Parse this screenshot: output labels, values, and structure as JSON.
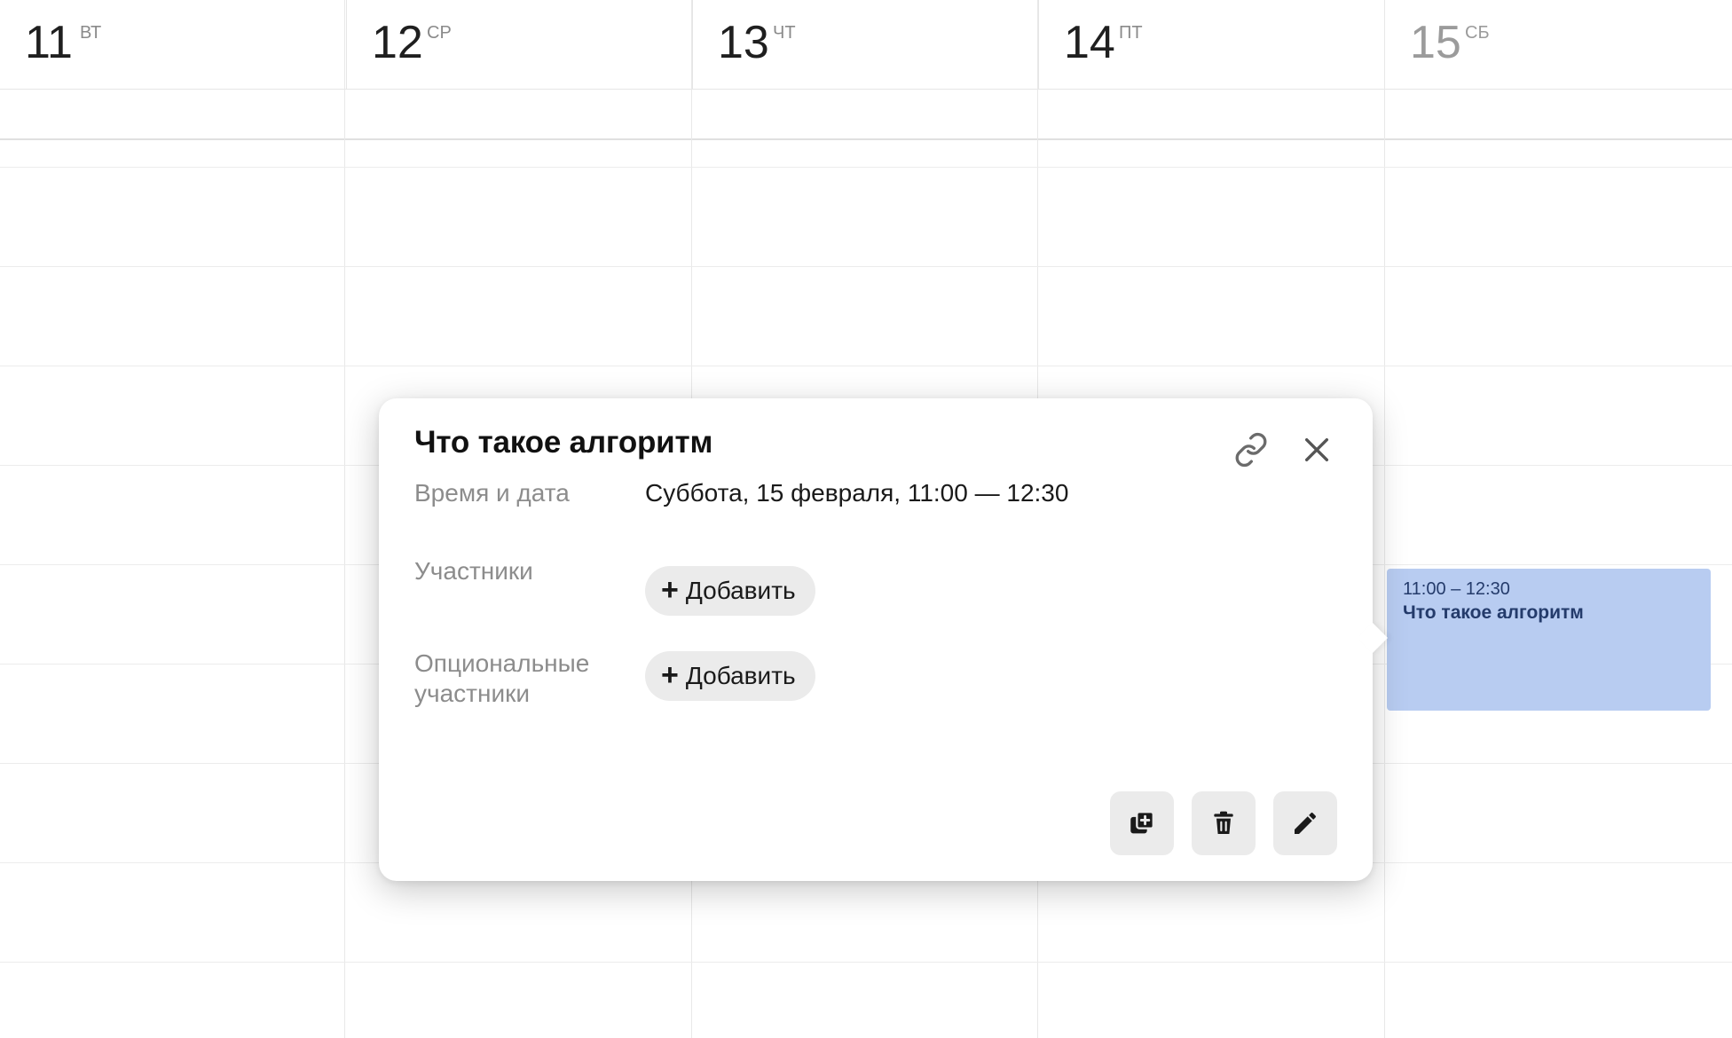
{
  "days": [
    {
      "num": "11",
      "weekday": "ВТ",
      "weekend": false
    },
    {
      "num": "12",
      "weekday": "СР",
      "weekend": false
    },
    {
      "num": "13",
      "weekday": "ЧТ",
      "weekend": false
    },
    {
      "num": "14",
      "weekday": "ПТ",
      "weekend": false
    },
    {
      "num": "15",
      "weekday": "СБ",
      "weekend": true
    }
  ],
  "event": {
    "time": "11:00 – 12:30",
    "title": "Что такое алгоритм",
    "color": "#b8ccf1"
  },
  "popup": {
    "title": "Что такое алгоритм",
    "link_icon": "link-icon",
    "close_icon": "close-icon",
    "datetime_label": "Время и дата",
    "datetime_value": "Суббота, 15 февраля, 11:00 — 12:30",
    "participants_label": "Участники",
    "optional_label_line1": "Опциональные",
    "optional_label_line2": "участники",
    "add_label": "Добавить",
    "actions": {
      "duplicate_icon": "duplicate-icon",
      "delete_icon": "trash-icon",
      "edit_icon": "pencil-icon"
    }
  }
}
